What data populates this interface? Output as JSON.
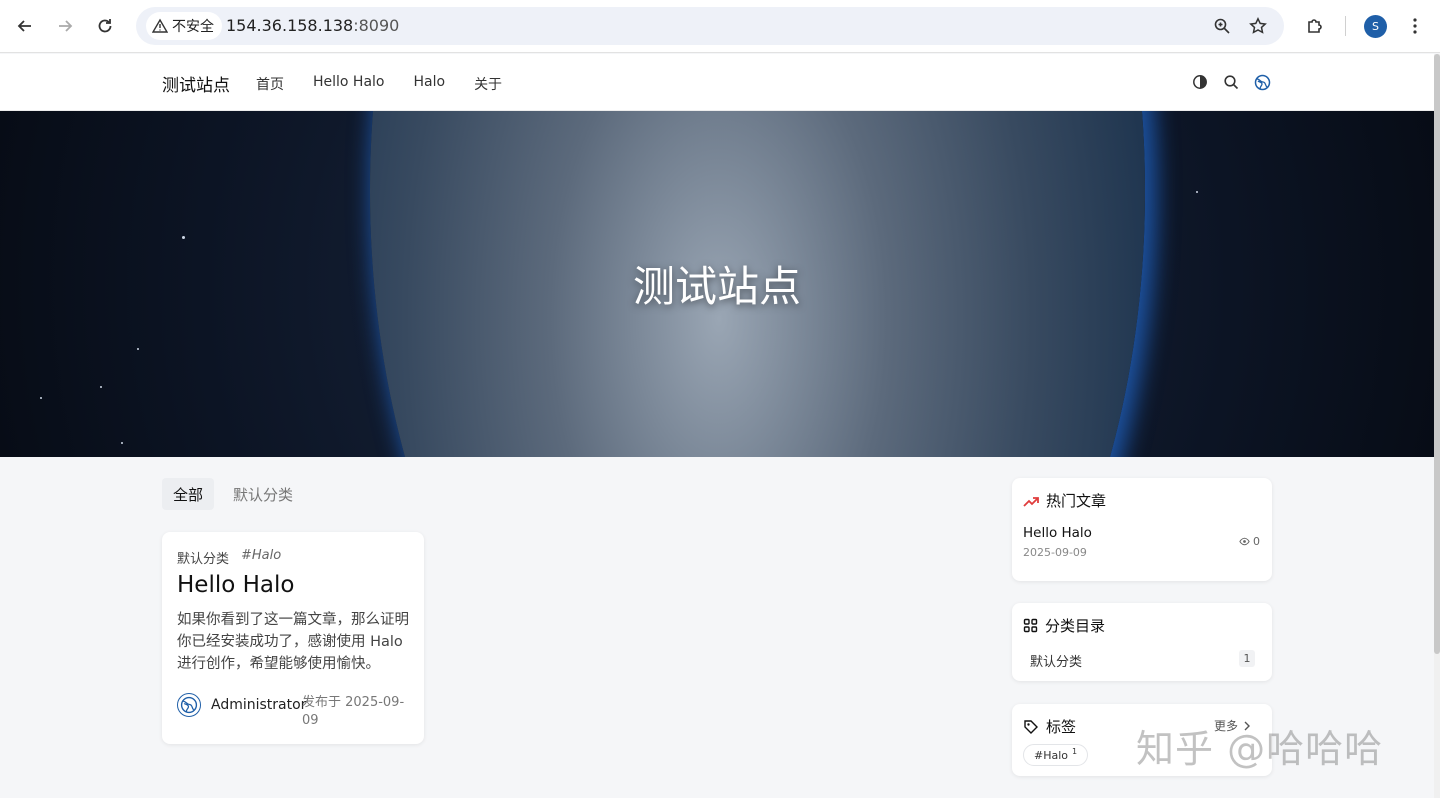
{
  "browser": {
    "security_label": "不安全",
    "url_host": "154.36.158.138",
    "url_port": ":8090",
    "profile_initial": "S"
  },
  "site": {
    "title": "测试站点",
    "menu": [
      "首页",
      "Hello Halo",
      "Halo",
      "关于"
    ]
  },
  "hero": {
    "title": "测试站点"
  },
  "tabs": [
    "全部",
    "默认分类"
  ],
  "post": {
    "category": "默认分类",
    "tag": "#Halo",
    "title": "Hello Halo",
    "excerpt": "如果你看到了这一篇文章，那么证明你已经安装成功了，感谢使用 Halo 进行创作，希望能够使用愉快。",
    "author": "Administrator",
    "published": "发布于 2025-09-09"
  },
  "widgets": {
    "hot": {
      "title": "热门文章",
      "item_title": "Hello Halo",
      "item_date": "2025-09-09",
      "item_views": "0"
    },
    "categories": {
      "title": "分类目录",
      "item_name": "默认分类",
      "item_count": "1"
    },
    "tags": {
      "title": "标签",
      "more": "更多",
      "item_name": "#Halo",
      "item_count": "1"
    }
  },
  "watermark": "知乎 @哈哈哈",
  "colors": {
    "accent": "#1f5fa8",
    "hot_icon": "#e03c3c"
  }
}
